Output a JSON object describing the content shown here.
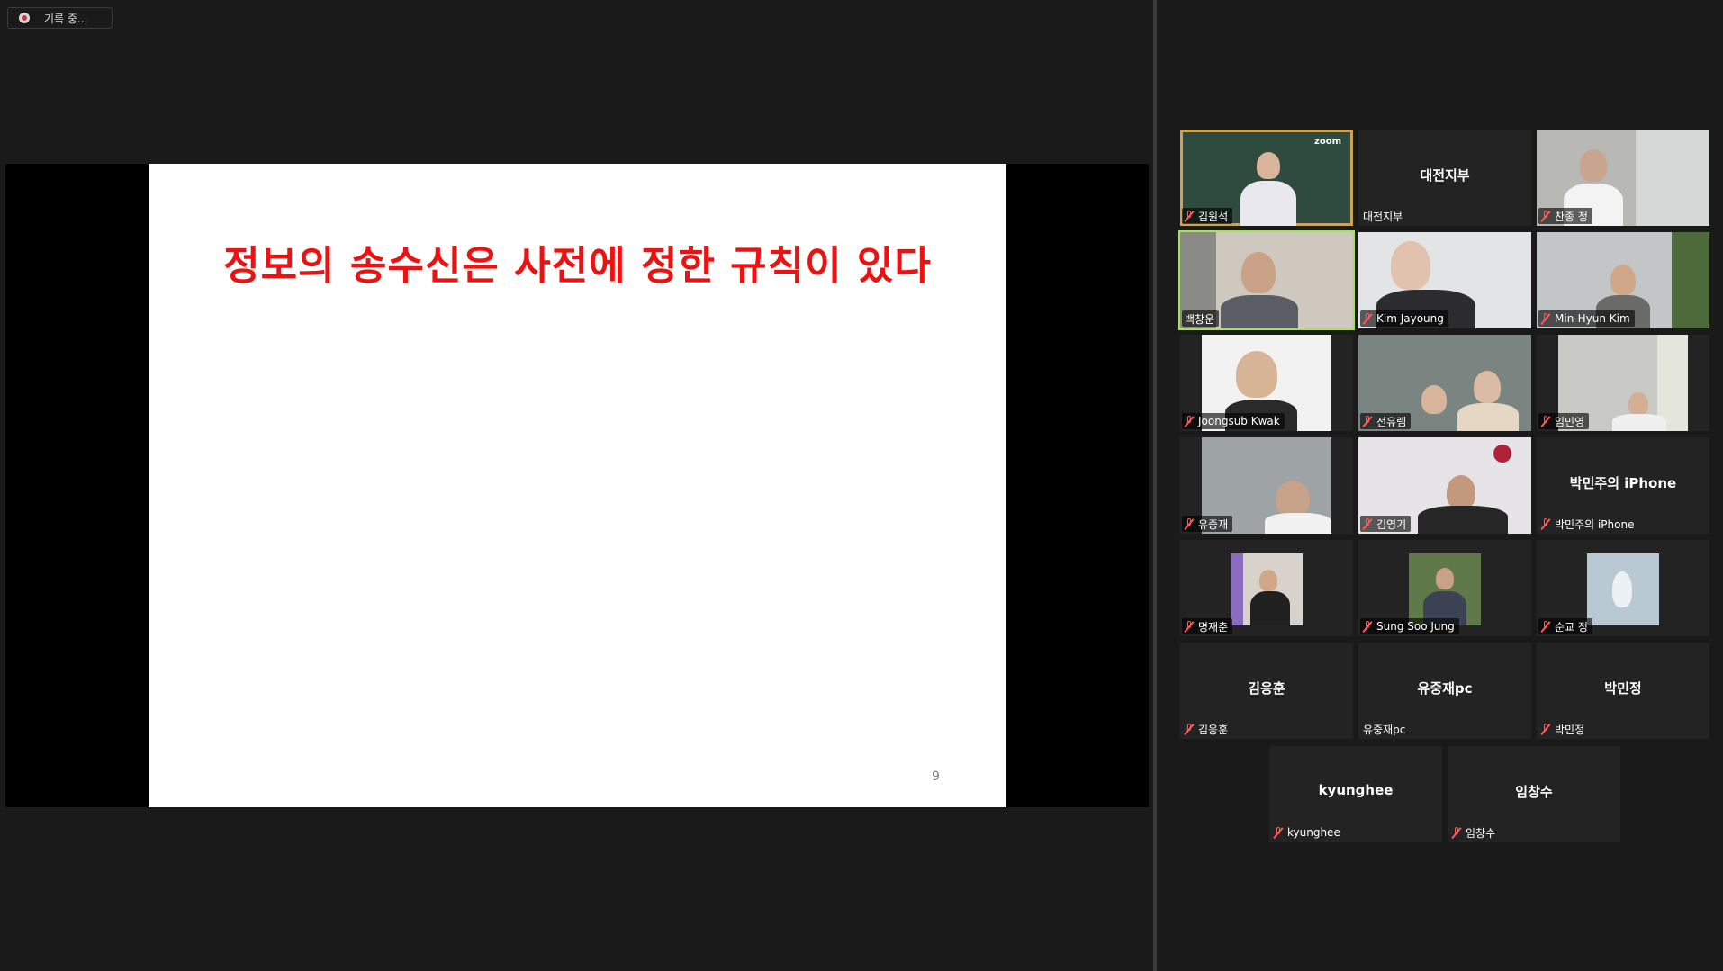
{
  "recording": {
    "label": "기록 중..."
  },
  "slide": {
    "title": "정보의 송수신은 사전에 정한 규칙이 있다",
    "page_number": "9",
    "title_color": "#ee1111"
  },
  "participants": {
    "p01": {
      "label": "김원석",
      "muted": true,
      "video": true
    },
    "p02": {
      "display_name": "대전지부",
      "label": "대전지부",
      "muted": false,
      "video": false
    },
    "p03": {
      "label": "찬종 정",
      "muted": true,
      "video": true
    },
    "p04": {
      "label": "백창운",
      "muted": false,
      "video": true,
      "active_speaker": true
    },
    "p05": {
      "label": "Kim Jayoung",
      "muted": true,
      "video": true
    },
    "p06": {
      "label": "Min-Hyun Kim",
      "muted": true,
      "video": true
    },
    "p07": {
      "label": "Joongsub Kwak",
      "muted": true,
      "video": true
    },
    "p08": {
      "label": "전유렘",
      "muted": true,
      "video": true
    },
    "p09": {
      "label": "임민영",
      "muted": true,
      "video": true
    },
    "p10": {
      "label": "유중재",
      "muted": true,
      "video": true
    },
    "p11": {
      "label": "김영기",
      "muted": true,
      "video": true
    },
    "p12": {
      "display_name": "박민주의 iPhone",
      "label": "박민주의 iPhone",
      "muted": true,
      "video": false
    },
    "p13": {
      "label": "명재춘",
      "muted": true,
      "video": true
    },
    "p14": {
      "label": "Sung Soo Jung",
      "muted": true,
      "video": true
    },
    "p15": {
      "label": "순교 정",
      "muted": true,
      "video": true
    },
    "p16": {
      "display_name": "김응훈",
      "label": "김응훈",
      "muted": true,
      "video": false
    },
    "p17": {
      "display_name": "유중재pc",
      "label": "유중재pc",
      "muted": false,
      "video": false
    },
    "p18": {
      "display_name": "박민정",
      "label": "박민정",
      "muted": true,
      "video": false
    },
    "p19": {
      "display_name": "kyunghee",
      "label": "kyunghee",
      "muted": true,
      "video": false
    },
    "p20": {
      "display_name": "임창수",
      "label": "임창수",
      "muted": true,
      "video": false
    }
  },
  "colors": {
    "background": "#1a1a1a",
    "tile_background": "#232323",
    "active_speaker_border": "#a7e05a",
    "muted_icon": "#ff5a5a"
  }
}
